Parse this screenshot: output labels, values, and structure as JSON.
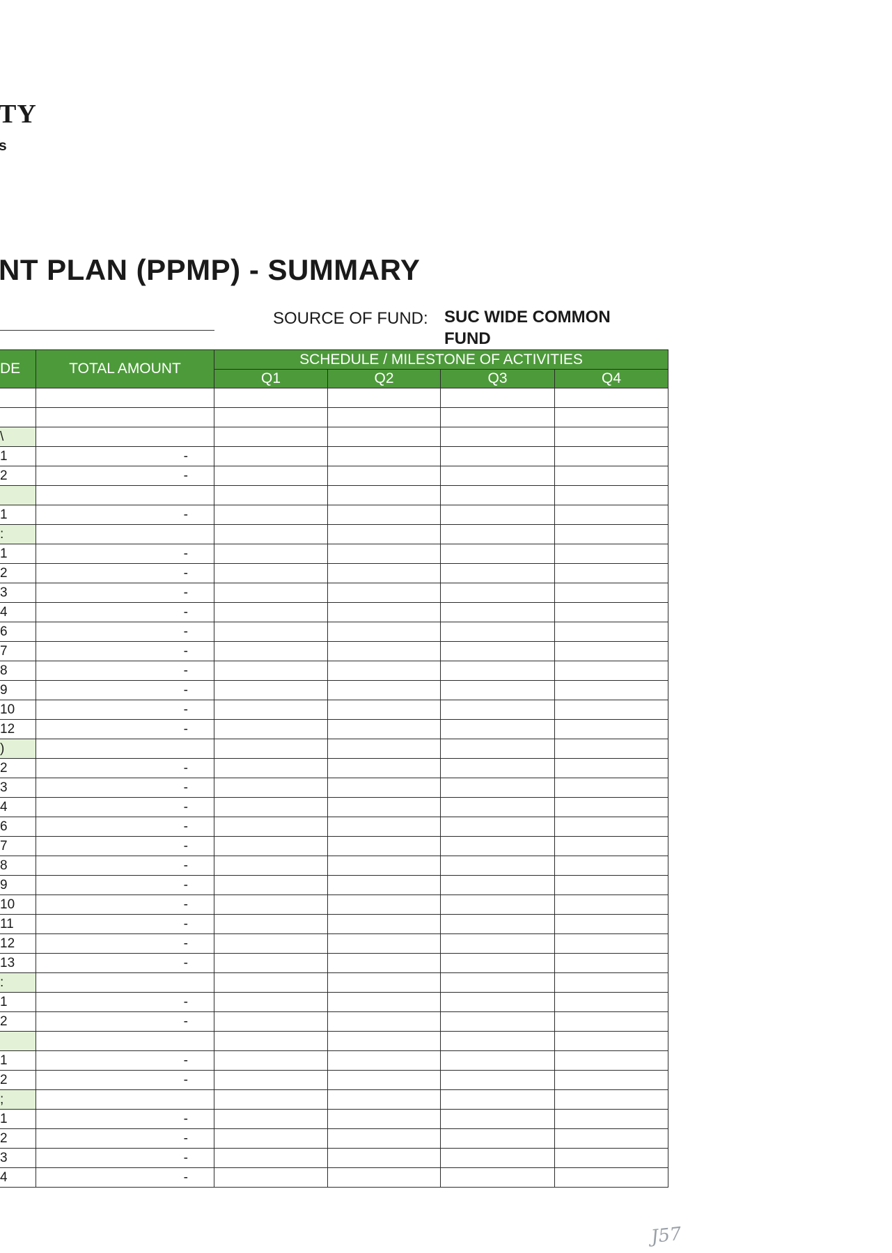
{
  "header": {
    "institution_partial": "TY",
    "campus_partial": "s"
  },
  "title": "NT PLAN (PPMP) - SUMMARY",
  "source_of_fund": {
    "label": "SOURCE OF FUND:",
    "value": "SUC WIDE COMMON FUND"
  },
  "table": {
    "code_header": "DE",
    "total_amount_header": "TOTAL AMOUNT",
    "schedule_header": "SCHEDULE / MILESTONE OF ACTIVITIES",
    "quarters": [
      "Q1",
      "Q2",
      "Q3",
      "Q4"
    ],
    "rows": [
      {
        "code": "",
        "amount": "",
        "cat": false
      },
      {
        "code": "",
        "amount": "",
        "cat": false
      },
      {
        "code": "\\",
        "amount": "",
        "cat": true
      },
      {
        "code": "1",
        "amount": "-",
        "cat": false
      },
      {
        "code": "2",
        "amount": "-",
        "cat": false
      },
      {
        "code": "",
        "amount": "",
        "cat": true
      },
      {
        "code": "1",
        "amount": "-",
        "cat": false
      },
      {
        "code": ":",
        "amount": "",
        "cat": true
      },
      {
        "code": "1",
        "amount": "-",
        "cat": false
      },
      {
        "code": "2",
        "amount": "-",
        "cat": false
      },
      {
        "code": "3",
        "amount": "-",
        "cat": false
      },
      {
        "code": "4",
        "amount": "-",
        "cat": false
      },
      {
        "code": "6",
        "amount": "-",
        "cat": false
      },
      {
        "code": "7",
        "amount": "-",
        "cat": false
      },
      {
        "code": "8",
        "amount": "-",
        "cat": false
      },
      {
        "code": "9",
        "amount": "-",
        "cat": false
      },
      {
        "code": "10",
        "amount": "-",
        "cat": false
      },
      {
        "code": "12",
        "amount": "-",
        "cat": false
      },
      {
        "code": ")",
        "amount": "",
        "cat": true
      },
      {
        "code": "2",
        "amount": "-",
        "cat": false
      },
      {
        "code": "3",
        "amount": "-",
        "cat": false
      },
      {
        "code": "4",
        "amount": "-",
        "cat": false
      },
      {
        "code": "6",
        "amount": "-",
        "cat": false
      },
      {
        "code": "7",
        "amount": "-",
        "cat": false
      },
      {
        "code": "8",
        "amount": "-",
        "cat": false
      },
      {
        "code": "9",
        "amount": "-",
        "cat": false
      },
      {
        "code": "10",
        "amount": "-",
        "cat": false
      },
      {
        "code": "11",
        "amount": "-",
        "cat": false
      },
      {
        "code": "12",
        "amount": "-",
        "cat": false
      },
      {
        "code": "13",
        "amount": "-",
        "cat": false
      },
      {
        "code": ":",
        "amount": "",
        "cat": true
      },
      {
        "code": "1",
        "amount": "-",
        "cat": false
      },
      {
        "code": "2",
        "amount": "-",
        "cat": false
      },
      {
        "code": "",
        "amount": "",
        "cat": true
      },
      {
        "code": "1",
        "amount": "-",
        "cat": false
      },
      {
        "code": "2",
        "amount": "-",
        "cat": false
      },
      {
        "code": ";",
        "amount": "",
        "cat": true
      },
      {
        "code": "1",
        "amount": "-",
        "cat": false
      },
      {
        "code": "2",
        "amount": "-",
        "cat": false
      },
      {
        "code": "3",
        "amount": "-",
        "cat": false
      },
      {
        "code": "4",
        "amount": "-",
        "cat": false
      }
    ]
  },
  "page_mark": "J57"
}
